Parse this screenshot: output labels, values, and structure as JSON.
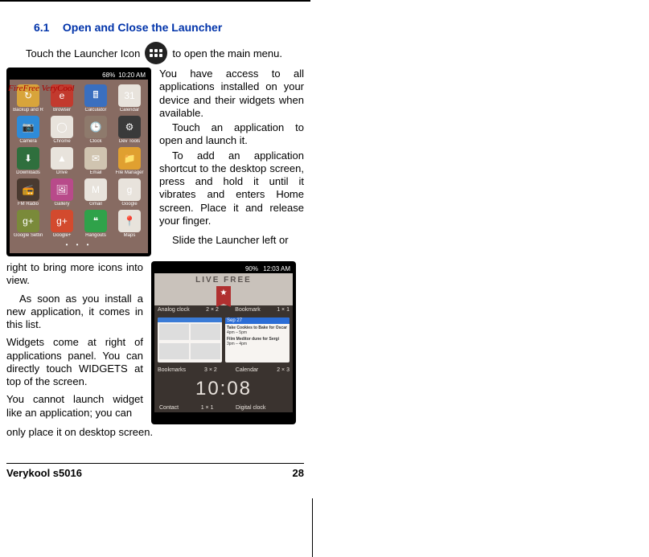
{
  "heading": {
    "number": "6.1",
    "title": "Open and Close the Launcher"
  },
  "intro": {
    "before_icon": "Touch the Launcher Icon",
    "after_icon": "to open the main menu."
  },
  "phone1": {
    "status": {
      "battery": "68%",
      "time": "10:20 AM"
    },
    "overlay": "FireFree\nVeryCool",
    "apps": [
      {
        "label": "Backup and R",
        "color": "#d8a43b",
        "glyph": "↻"
      },
      {
        "label": "Browser",
        "color": "#c23a2e",
        "glyph": "e"
      },
      {
        "label": "Calculator",
        "color": "#3a6fbf",
        "glyph": "🖩"
      },
      {
        "label": "Calendar",
        "color": "#e8e3dc",
        "glyph": "31"
      },
      {
        "label": "Camera",
        "color": "#2e8bd8",
        "glyph": "📷"
      },
      {
        "label": "Chrome",
        "color": "#e8e3dc",
        "glyph": "◯"
      },
      {
        "label": "Clock",
        "color": "#8e7a6c",
        "glyph": "🕒"
      },
      {
        "label": "Dev Tools",
        "color": "#3a3a3a",
        "glyph": "⚙"
      },
      {
        "label": "Downloads",
        "color": "#2f6f3d",
        "glyph": "⬇"
      },
      {
        "label": "Drive",
        "color": "#e8e3dc",
        "glyph": "▲"
      },
      {
        "label": "Email",
        "color": "#d0c4b0",
        "glyph": "✉"
      },
      {
        "label": "File Manager",
        "color": "#e0a030",
        "glyph": "📁"
      },
      {
        "label": "FM Radio",
        "color": "#4a3a30",
        "glyph": "📻"
      },
      {
        "label": "Gallery",
        "color": "#b84a8a",
        "glyph": "🖼"
      },
      {
        "label": "Gmail",
        "color": "#e8e3dc",
        "glyph": "M"
      },
      {
        "label": "Google",
        "color": "#e8e3dc",
        "glyph": "g"
      },
      {
        "label": "Google Settin",
        "color": "#7a8a3a",
        "glyph": "g+"
      },
      {
        "label": "Google+",
        "color": "#d34a2e",
        "glyph": "g+"
      },
      {
        "label": "Hangouts",
        "color": "#2fa24a",
        "glyph": "❝"
      },
      {
        "label": "Maps",
        "color": "#e8e3dc",
        "glyph": "📍"
      }
    ]
  },
  "right_col": {
    "p1": "You have access to all applications installed on your device and their widgets when available.",
    "p2": "Touch an application to open and launch it.",
    "p3": "To add an application shortcut to the desktop screen, press and hold it until it vibrates and enters Home screen. Place it and release your finger.",
    "p4": "Slide the Launcher left or"
  },
  "left_col": {
    "p1": "right to bring more icons into view.",
    "p2": "As soon as you install a new application, it comes in this list.",
    "p3": "Widgets come at right of applications panel. You can directly touch WIDGETS at top of the screen.",
    "p4": "You cannot launch widget like an application; you can"
  },
  "closing": "only place it on desktop screen.",
  "phone2": {
    "status": {
      "battery": "90%",
      "time": "12:03 AM"
    },
    "wallpaper": "LIVE FREE",
    "star": "★",
    "row_labels": {
      "analog_left": "Analog clock",
      "analog_right": "2 × 2",
      "bookmark_left": "Bookmark",
      "bookmark_right": "1 × 1"
    },
    "row2_labels": {
      "bm_left": "Bookmarks",
      "bm_right": "3 × 2",
      "cal_left": "Calendar",
      "cal_right": "2 × 3"
    },
    "calendar_card": {
      "date": "Sep 27",
      "item1_title": "Take Cookies to Bake for Oscar",
      "item1_time": "4pm – 5pm",
      "item2_title": "Film Meditor dune for Sergi",
      "item2_time": "3pm – 4pm"
    },
    "clock_time": "10:08",
    "footer_labels": {
      "left_l": "Contact",
      "left_r": "1 × 1",
      "right_l": "Digital clock",
      "right_r": ""
    }
  },
  "footer": {
    "model": "Verykool s5016",
    "page": "28"
  }
}
